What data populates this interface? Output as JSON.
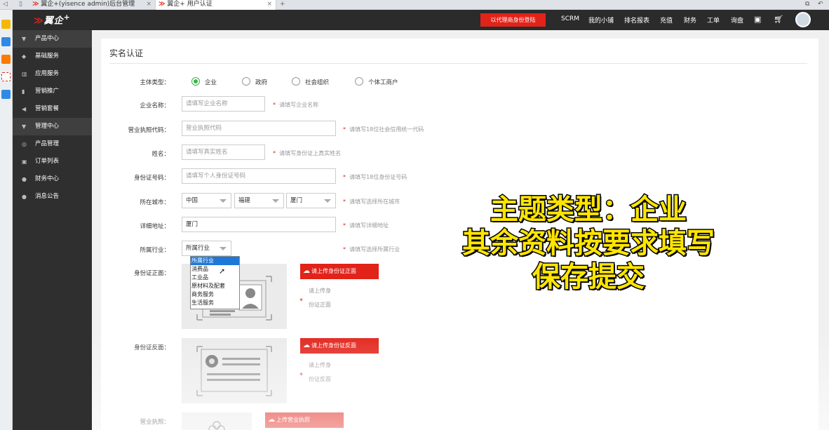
{
  "browser": {
    "tabs": [
      {
        "label": "翼企+(yisence admin)后台管理",
        "active": false
      },
      {
        "label": "翼企+ 用户认证",
        "active": true
      }
    ],
    "new_tab": "+",
    "close_glyph": "×"
  },
  "header": {
    "brand": "翼企",
    "brand_plus": "+",
    "agent_login": "以代理商身份登陆",
    "nav": [
      "SCRM",
      "我的小铺",
      "排名报表",
      "充值",
      "财务",
      "工单",
      "询盘"
    ]
  },
  "sidebar": {
    "items": [
      {
        "label": "产品中心",
        "group": true,
        "icon": "triangle-down-icon"
      },
      {
        "label": "基础服务",
        "group": false,
        "icon": "cube-icon"
      },
      {
        "label": "应用服务",
        "group": false,
        "icon": "building-icon"
      },
      {
        "label": "营销推广",
        "group": false,
        "icon": "bar-chart-icon"
      },
      {
        "label": "营销套餐",
        "group": false,
        "icon": "megaphone-icon"
      },
      {
        "label": "管理中心",
        "group": true,
        "icon": "triangle-down-icon"
      },
      {
        "label": "产品管理",
        "group": false,
        "icon": "box-icon"
      },
      {
        "label": "订单列表",
        "group": false,
        "icon": "lock-icon"
      },
      {
        "label": "财务中心",
        "group": false,
        "icon": "money-bag-icon"
      },
      {
        "label": "消息公告",
        "group": false,
        "icon": "chat-icon"
      }
    ]
  },
  "form": {
    "title": "实名认证",
    "subject_type": {
      "label": "主体类型：",
      "options": [
        "企业",
        "政府",
        "社会组织",
        "个体工商户"
      ],
      "selected": "企业"
    },
    "company_name": {
      "label": "企业名称：",
      "placeholder": "请填写企业名称",
      "hint": "请填写企业名称"
    },
    "license_code": {
      "label": "营业执照代码：",
      "placeholder": "营业执照代码",
      "hint": "请填写18位社会信用统一代码"
    },
    "name": {
      "label": "姓名：",
      "placeholder": "请填写真实姓名",
      "hint": "请填写身份证上真实姓名"
    },
    "id_number": {
      "label": "身份证号码：",
      "placeholder": "请填写个人身份证号码",
      "hint": "请填写18位身份证号码"
    },
    "city": {
      "label": "所在城市：",
      "country": "中国",
      "province": "福建",
      "city": "厦门",
      "hint": "请填写选择所在城市"
    },
    "address": {
      "label": "详细地址：",
      "value": "厦门",
      "hint": "请填写详细地址"
    },
    "industry": {
      "label": "所属行业：",
      "value": "所属行业",
      "hint": "请填写选择所属行业",
      "options": [
        "所属行业",
        "消费品",
        "工业品",
        "原材料及配套",
        "商务服务",
        "生活服务"
      ]
    },
    "id_front": {
      "label": "身份证正面：",
      "button": "请上传身份证正面",
      "hint_line1": "请上传身",
      "hint_line2": "份证正面"
    },
    "id_back": {
      "label": "身份证反面：",
      "button": "请上传身份证反面",
      "hint_line1": "请上传身",
      "hint_line2": "份证反面"
    },
    "business_license": {
      "label": "营业执照：",
      "button": "上传营业执照"
    },
    "required_mark": "*"
  },
  "caption": {
    "line1": "主题类型：企业",
    "line2": "其余资料按要求填写",
    "line3": "保存提交"
  },
  "colors": {
    "accent": "#e2231a",
    "radio_on": "#3bb34a",
    "caption": "#ffe500",
    "header_bg": "#2b2b2b",
    "sidebar_bg": "#2f2f2f"
  }
}
